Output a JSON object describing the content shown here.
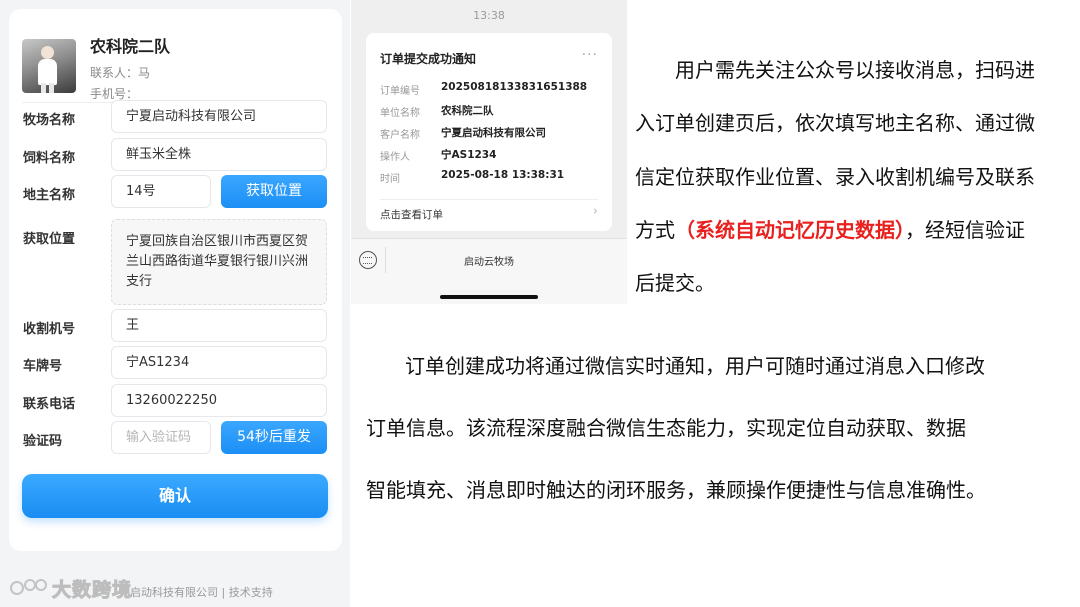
{
  "form": {
    "team_name": "农科院二队",
    "contact": "联系人：马",
    "phone": "手机号：",
    "rows": {
      "ranch_label": "牧场名称",
      "ranch_value": "宁夏启动科技有限公司",
      "feed_label": "饲料名称",
      "feed_value": "鲜玉米全株",
      "landlord_label": "地主名称",
      "landlord_value": "14号",
      "get_location_button": "获取位置",
      "location_label": "获取位置",
      "location_value": "宁夏回族自治区银川市西夏区贺兰山西路街道华夏银行银川兴洲支行",
      "harvester_label": "收割机号",
      "harvester_value": "王",
      "plate_label": "车牌号",
      "plate_value": "宁AS1234",
      "tel_label": "联系电话",
      "tel_value": "13260022250",
      "code_label": "验证码",
      "code_placeholder": "输入验证码",
      "resend_button": "54秒后重发"
    },
    "confirm_button": "确认"
  },
  "footer": {
    "text": "启动科技有限公司 | 技术支持",
    "watermark": "大数跨境"
  },
  "message": {
    "time": "13:38",
    "title": "订单提交成功通知",
    "fields": [
      {
        "key": "订单编号",
        "value": "20250818133831651388"
      },
      {
        "key": "单位名称",
        "value": "农科院二队"
      },
      {
        "key": "客户名称",
        "value": "宁夏启动科技有限公司"
      },
      {
        "key": "操作人",
        "value": "宁AS1234"
      },
      {
        "key": "时间",
        "value": "2025-08-18 13:38:31"
      }
    ],
    "view_link": "点击查看订单",
    "menu_label": "启动云牧场"
  },
  "description": {
    "p1_l1": "用户需先关注公众号以接收消息，扫码进",
    "p1_l2": "入订单创建页后，依次填写地主名称、通过微",
    "p1_l3": "信定位获取作业位置、录入收割机编号及联系",
    "p1_l4a": "方式",
    "p1_l4_highlight": "（系统自动记忆历史数据）",
    "p1_l4b": "，经短信验证",
    "p1_l5": "后提交。",
    "p2_l1": "订单创建成功将通过微信实时通知，用户可随时通过消息入口修改",
    "p2_l2": "订单信息。该流程深度融合微信生态能力，实现定位自动获取、数据",
    "p2_l3": "智能填充、消息即时触达的闭环服务，兼顾操作便捷性与信息准确性。"
  },
  "colors": {
    "accent_blue": "#1c8ff5",
    "highlight_red": "#e8211f"
  }
}
